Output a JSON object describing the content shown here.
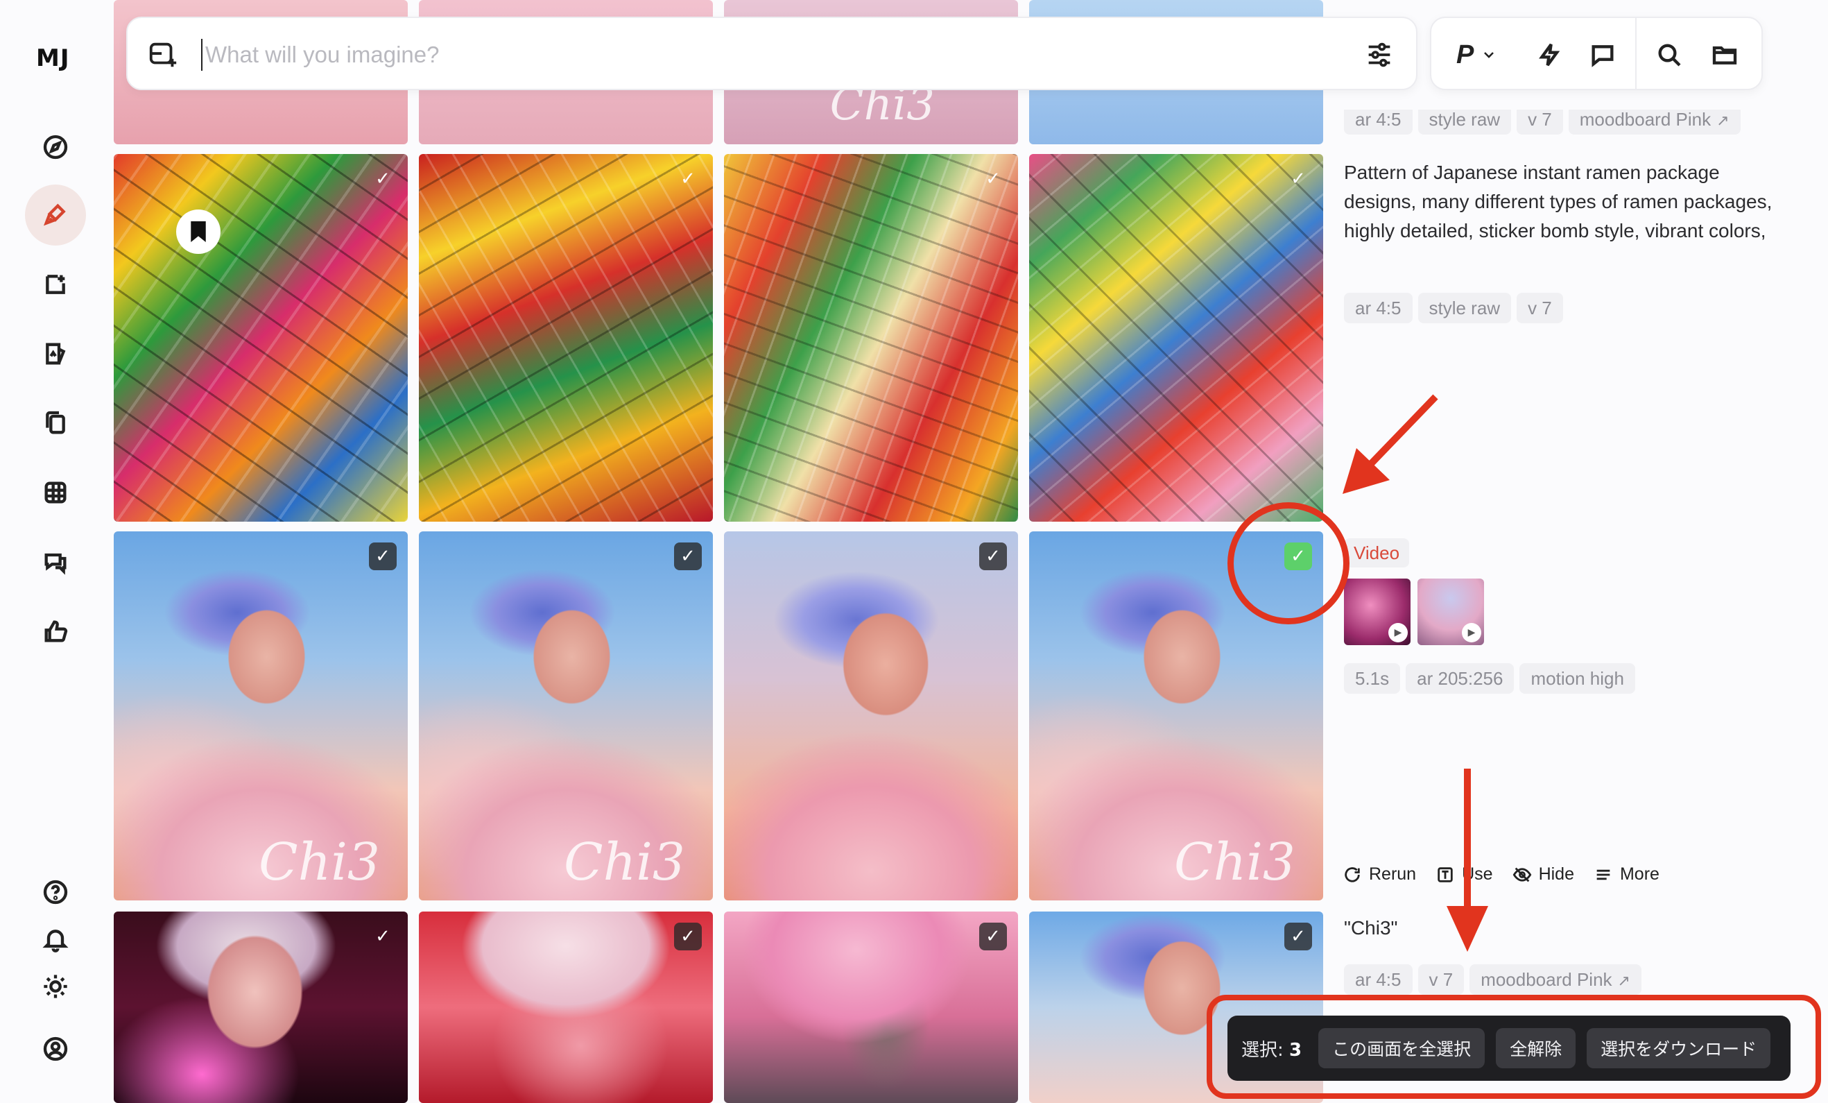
{
  "app": {
    "logo": "MJ"
  },
  "sidebar": {
    "items": [
      {
        "name": "explore",
        "icon": "compass-icon"
      },
      {
        "name": "create",
        "icon": "brush-icon",
        "active": true
      },
      {
        "name": "edit",
        "icon": "edit-icon"
      },
      {
        "name": "personalize",
        "icon": "personalize-icon"
      },
      {
        "name": "organize",
        "icon": "copy-icon"
      },
      {
        "name": "moodboards",
        "icon": "grid-icon"
      },
      {
        "name": "chat",
        "icon": "chat-icon"
      },
      {
        "name": "rank",
        "icon": "thumbs-up-icon"
      }
    ],
    "bottom": [
      {
        "name": "help",
        "icon": "help-icon"
      },
      {
        "name": "notifications",
        "icon": "bell-icon"
      },
      {
        "name": "theme",
        "icon": "sun-icon"
      },
      {
        "name": "account",
        "icon": "user-icon"
      }
    ]
  },
  "prompt": {
    "placeholder": "What will you imagine?",
    "mode_letter": "P"
  },
  "jobs": [
    {
      "prompt": "Pattern of Japanese instant ramen package designs, many different types of ramen packages, highly detailed, sticker bomb style, vibrant colors,",
      "chips": [
        "ar 4:5",
        "style raw",
        "v 7"
      ]
    },
    {
      "video_tag": "Video",
      "chips": [
        "5.1s",
        "ar 205:256",
        "motion high"
      ]
    },
    {
      "actions": [
        "Rerun",
        "Use",
        "Hide",
        "More"
      ],
      "prompt": "\"Chi3\"",
      "chips": [
        "ar 4:5",
        "v 7",
        "moodboard Pink"
      ]
    }
  ],
  "top_chips": [
    "ar 4:5",
    "style raw",
    "v 7",
    "moodboard Pink"
  ],
  "watermark": "Chi3",
  "selection": {
    "label": "選択: ",
    "count": "3",
    "select_all": "この画面を全選択",
    "deselect_all": "全解除",
    "download": "選択をダウンロード"
  },
  "colors": {
    "accent": "#d6452e",
    "annotation": "#e1341e",
    "check_green": "#5dd06a"
  }
}
